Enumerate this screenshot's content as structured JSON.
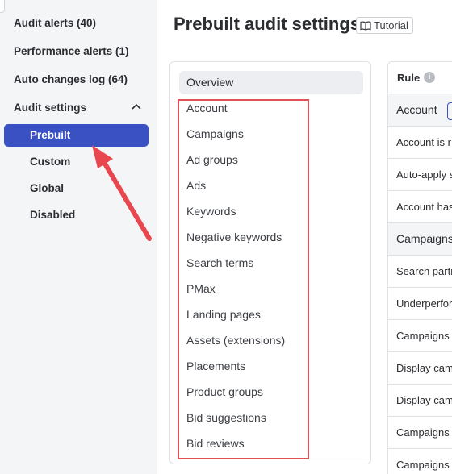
{
  "sidebar": {
    "items": [
      {
        "label": "Audit alerts (40)"
      },
      {
        "label": "Performance alerts (1)"
      },
      {
        "label": "Auto changes log (64)"
      },
      {
        "label": "Audit settings"
      }
    ],
    "sub_items": [
      {
        "label": "Prebuilt",
        "active": true
      },
      {
        "label": "Custom"
      },
      {
        "label": "Global"
      },
      {
        "label": "Disabled"
      }
    ]
  },
  "header": {
    "title": "Prebuilt audit settings",
    "tutorial_label": "Tutorial"
  },
  "categories": {
    "selected": "Overview",
    "items": [
      "Account",
      "Campaigns",
      "Ad groups",
      "Ads",
      "Keywords",
      "Negative keywords",
      "Search terms",
      "PMax",
      "Landing pages",
      "Assets (extensions)",
      "Placements",
      "Product groups",
      "Bid suggestions",
      "Bid reviews"
    ]
  },
  "rules_table": {
    "header": "Rule",
    "rows": [
      {
        "type": "group",
        "text": "Account"
      },
      {
        "type": "rule",
        "text": "Account is r"
      },
      {
        "type": "rule",
        "text": "Auto-apply s"
      },
      {
        "type": "rule",
        "text": "Account has"
      },
      {
        "type": "group",
        "text": "Campaigns"
      },
      {
        "type": "rule",
        "text": "Search partn"
      },
      {
        "type": "rule",
        "text": "Underperfor"
      },
      {
        "type": "rule",
        "text": "Campaigns"
      },
      {
        "type": "rule",
        "text": "Display cam"
      },
      {
        "type": "rule",
        "text": "Display cam"
      },
      {
        "type": "rule",
        "text": "Campaigns"
      },
      {
        "type": "rule",
        "text": "Campaigns"
      }
    ]
  },
  "colors": {
    "accent": "#3a51c4",
    "annotation": "#e0525a"
  }
}
